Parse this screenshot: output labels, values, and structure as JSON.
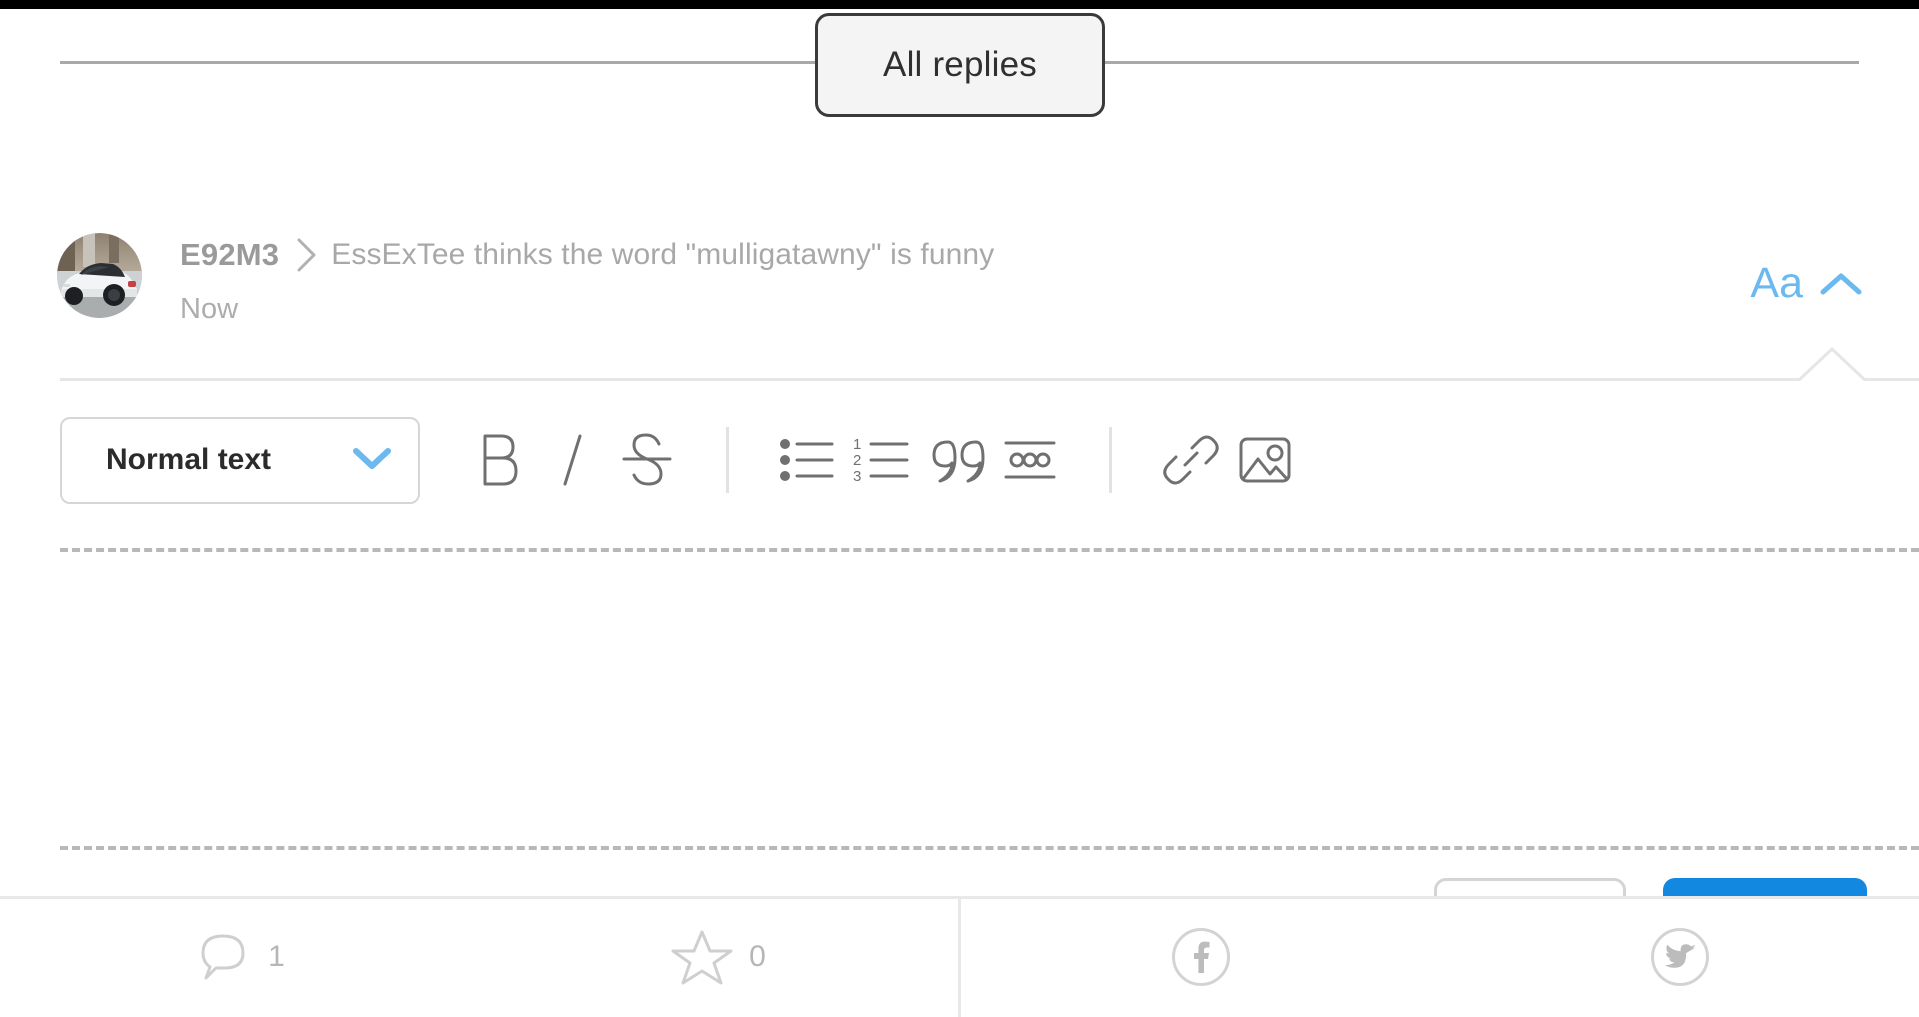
{
  "tabs": {
    "active_label": "All replies"
  },
  "post": {
    "author": "E92M3",
    "separator_icon": "chevron-right-icon",
    "thread_title": "EssExTee thinks the word \"mulligatawny\" is funny",
    "timestamp": "Now",
    "avatar_icon": "user-avatar-car-photo"
  },
  "font_control": {
    "label": "Aa",
    "chevron_icon": "chevron-up-icon",
    "color": "#6bb9ef"
  },
  "editor": {
    "style_select": {
      "value": "Normal text",
      "chevron_icon": "chevron-down-icon",
      "chevron_color": "#6bb9ef"
    },
    "tools": [
      {
        "name": "bold-icon",
        "label": "B"
      },
      {
        "name": "italic-icon",
        "label": "I"
      },
      {
        "name": "strikethrough-icon",
        "label": "S"
      },
      {
        "name": "bulleted-list-icon",
        "label": "Bulleted list"
      },
      {
        "name": "numbered-list-icon",
        "label": "Numbered list"
      },
      {
        "name": "blockquote-icon",
        "label": "Quote"
      },
      {
        "name": "horizontal-rule-icon",
        "label": "Horizontal rule"
      },
      {
        "name": "link-icon",
        "label": "Link"
      },
      {
        "name": "image-icon",
        "label": "Image"
      }
    ],
    "numbered_list_digits": [
      "1",
      "2",
      "3"
    ],
    "body_value": "",
    "body_placeholder": ""
  },
  "actions": {
    "cancel_label": "",
    "post_label": "",
    "post_color": "#1288e0"
  },
  "bottom_bar": {
    "comments": {
      "icon": "comment-bubble-icon",
      "count": "1"
    },
    "favorites": {
      "icon": "star-icon",
      "count": "0"
    },
    "share_facebook": {
      "icon": "facebook-icon"
    },
    "share_twitter": {
      "icon": "twitter-icon"
    }
  }
}
